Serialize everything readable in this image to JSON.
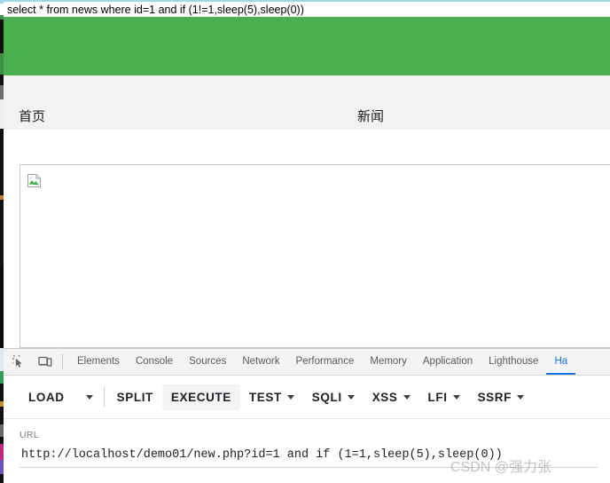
{
  "sql_query_bar": {
    "text": "select * from news where id=1 and if (1!=1,sleep(5),sleep(0))"
  },
  "website": {
    "banner_color": "#4caf50",
    "navbar_bg": "#f2f2f2",
    "nav_links": [
      {
        "label": "首页",
        "name": "nav-link-home"
      },
      {
        "label": "新闻",
        "name": "nav-link-news"
      }
    ],
    "content": {
      "broken_image_icon": "broken-image-icon"
    }
  },
  "devtools": {
    "inspect_icon": "inspect-element-icon",
    "device_toolbar_icon": "device-toolbar-icon",
    "tabs": [
      {
        "label": "Elements",
        "active": false
      },
      {
        "label": "Console",
        "active": false
      },
      {
        "label": "Sources",
        "active": false
      },
      {
        "label": "Network",
        "active": false
      },
      {
        "label": "Performance",
        "active": false
      },
      {
        "label": "Memory",
        "active": false
      },
      {
        "label": "Application",
        "active": false
      },
      {
        "label": "Lighthouse",
        "active": false
      },
      {
        "label": "Ha",
        "active": true
      }
    ],
    "active_tab_color": "#1a73e8"
  },
  "hackbar": {
    "buttons": [
      {
        "label": "LOAD",
        "caret": false,
        "highlight": false,
        "name": "load-button"
      },
      {
        "label": "SPLIT",
        "caret": false,
        "highlight": false,
        "name": "split-button"
      },
      {
        "label": "EXECUTE",
        "caret": false,
        "highlight": true,
        "name": "execute-button"
      },
      {
        "label": "TEST",
        "caret": true,
        "highlight": false,
        "name": "test-button"
      },
      {
        "label": "SQLI",
        "caret": true,
        "highlight": false,
        "name": "sqli-button"
      },
      {
        "label": "XSS",
        "caret": true,
        "highlight": false,
        "name": "xss-button"
      },
      {
        "label": "LFI",
        "caret": true,
        "highlight": false,
        "name": "lfi-button"
      },
      {
        "label": "SSRF",
        "caret": true,
        "highlight": false,
        "name": "ssrf-button"
      }
    ],
    "load_dropdown_caret": "chevron-down-icon",
    "url_label": "URL",
    "url_value": "http://localhost/demo01/new.php?id=1 and if (1=1,sleep(5),sleep(0))",
    "url_placeholder": "URL"
  },
  "watermark": {
    "text": "CSDN @强力张"
  }
}
